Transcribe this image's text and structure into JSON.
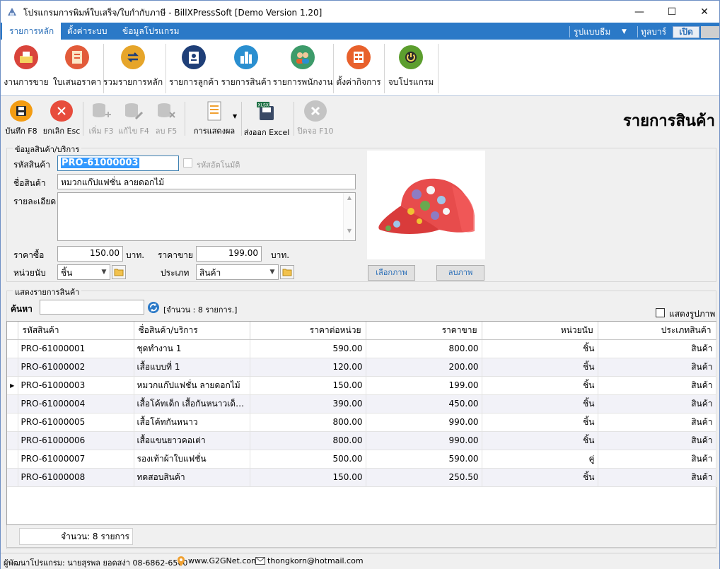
{
  "window": {
    "title": "โปรแกรมการพิมพ์ใบเสร็จ/ใบกำกับภาษี - BillXPressSoft [Demo Version 1.20]",
    "minimize": "—",
    "maximize": "☐",
    "close": "✕"
  },
  "ribbon_tabs": [
    "รายการหลัก",
    "ตั้งค่าระบบ",
    "ข้อมูลโปรแกรม"
  ],
  "ribbon_right": {
    "theme_label": "รูปแบบธีม",
    "toolbar_label": "ทูลบาร์",
    "toolbar_state": "เปิด"
  },
  "ribbon_buttons": [
    {
      "label": "งานการขาย",
      "icon": "cash-register-icon",
      "color": "#d9443b"
    },
    {
      "label": "ใบเสนอราคา",
      "icon": "quotation-icon",
      "color": "#e25b3a"
    },
    {
      "label": "รวมรายการหลัก",
      "icon": "transfer-icon",
      "color": "#e6a52a"
    },
    {
      "label": "รายการลูกค้า",
      "icon": "customer-card-icon",
      "color": "#1f3f78"
    },
    {
      "label": "รายการสินค้า",
      "icon": "product-city-icon",
      "color": "#2a8fd0"
    },
    {
      "label": "รายการพนักงาน",
      "icon": "employees-icon",
      "color": "#3d9b6a"
    },
    {
      "label": "ตั้งค่ากิจการ",
      "icon": "business-settings-icon",
      "color": "#e8612c"
    },
    {
      "label": "จบโปรแกรม",
      "icon": "power-icon",
      "color": "#5c9e2e"
    }
  ],
  "toolbar": {
    "save": "บันทึก F8",
    "cancel": "ยกเลิก Esc",
    "add": "เพิ่ม F3",
    "edit": "แก้ไข F4",
    "delete": "ลบ F5",
    "display": "การแสดงผล",
    "export": "ส่งออก Excel",
    "close": "ปิดจอ F10",
    "export_badge": "XLSX"
  },
  "page_title": "รายการสินค้า",
  "product_form": {
    "group_title": "ข้อมูลสินค้า/บริการ",
    "code_label": "รหัสสินค้า",
    "code_value": "PRO-61000003",
    "auto_code_label": "รหัสอัตโนมัติ",
    "name_label": "ชื่อสินค้า",
    "name_value": "หมวกแก๊ปแฟชั่น ลายดอกไม้",
    "detail_label": "รายละเอียด",
    "detail_value": "",
    "cost_label": "ราคาซื้อ",
    "cost_value": "150.00",
    "baht1": "บาท.",
    "price_label": "ราคาขาย",
    "price_value": "199.00",
    "baht2": "บาท.",
    "unit_label": "หน่วยนับ",
    "unit_value": "ชิ้น",
    "type_label": "ประเภท",
    "type_value": "สินค้า",
    "choose_image": "เลือกภาพ",
    "delete_image": "ลบภาพ"
  },
  "list": {
    "group_title": "แสดงรายการสินค้า",
    "search_label": "ค้นหา",
    "search_value": "",
    "count_text": "[จำนวน : 8 รายการ.]",
    "show_image_label": "แสดงรูปภาพ",
    "columns": [
      "รหัสสินค้า",
      "ชื่อสินค้า/บริการ",
      "ราคาต่อหน่วย",
      "ราคาขาย",
      "หน่วยนับ",
      "ประเภทสินค้า"
    ],
    "rows": [
      [
        "PRO-61000001",
        "ชุดทำงาน 1",
        "590.00",
        "800.00",
        "ชิ้น",
        "สินค้า"
      ],
      [
        "PRO-61000002",
        "เสื้อแบบที่ 1",
        "120.00",
        "200.00",
        "ชิ้น",
        "สินค้า"
      ],
      [
        "PRO-61000003",
        "หมวกแก๊ปแฟชั่น ลายดอกไม้",
        "150.00",
        "199.00",
        "ชิ้น",
        "สินค้า"
      ],
      [
        "PRO-61000004",
        "เสื้อโค้ทเด็ก เสื้อกันหนาวเด็ก ...",
        "390.00",
        "450.00",
        "ชิ้น",
        "สินค้า"
      ],
      [
        "PRO-61000005",
        "เสื้อโค้ทกันหนาว",
        "800.00",
        "990.00",
        "ชิ้น",
        "สินค้า"
      ],
      [
        "PRO-61000006",
        "เสื้อแขนยาวคอเต่า",
        "800.00",
        "990.00",
        "ชิ้น",
        "สินค้า"
      ],
      [
        "PRO-61000007",
        "รองเท้าผ้าใบแฟชั่น",
        "500.00",
        "590.00",
        "คู่",
        "สินค้า"
      ],
      [
        "PRO-61000008",
        "ทดสอบสินค้า",
        "150.00",
        "250.50",
        "ชิ้น",
        "สินค้า"
      ]
    ],
    "current_row_marker": "▶",
    "footer_count": "จำนวน: 8 รายการ"
  },
  "statusbar": {
    "developer": "ผู้พัฒนาโปรแกรม: นายสุรพล ยอดสง่า 08-6862-6560",
    "website": "www.G2GNet.com",
    "email": "thongkorn@hotmail.com"
  },
  "colors": {
    "accent": "#2b79c7",
    "selection": "#3399ff"
  }
}
